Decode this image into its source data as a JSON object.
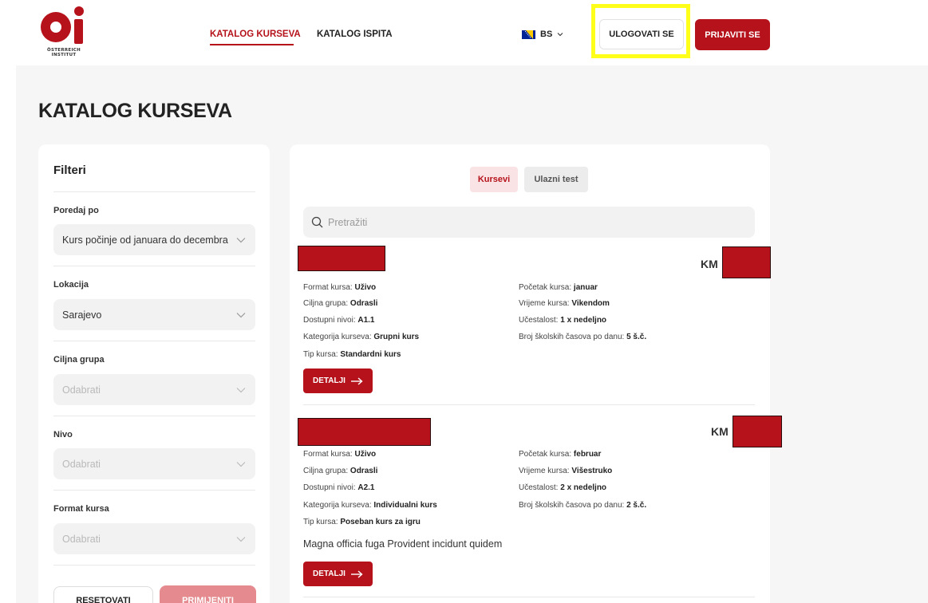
{
  "header": {
    "logo_text_line1": "ÖSTERREICH",
    "logo_text_line2": "INSTITUT",
    "nav": [
      {
        "label": "KATALOG KURSEVA",
        "active": true
      },
      {
        "label": "KATALOG ISPITA",
        "active": false
      }
    ],
    "language": "BS",
    "login_label": "ULOGOVATI SE",
    "register_label": "PRIJAVITI SE"
  },
  "page_title": "KATALOG KURSEVA",
  "filters": {
    "title": "Filteri",
    "groups": [
      {
        "label": "Poredaj po",
        "value": "Kurs počinje od januara do decembra",
        "is_placeholder": false
      },
      {
        "label": "Lokacija",
        "value": "Sarajevo",
        "is_placeholder": false
      },
      {
        "label": "Ciljna grupa",
        "value": "Odabrati",
        "is_placeholder": true
      },
      {
        "label": "Nivo",
        "value": "Odabrati",
        "is_placeholder": true
      },
      {
        "label": "Format kursa",
        "value": "Odabrati",
        "is_placeholder": true
      }
    ],
    "reset_label": "RESETOVATI",
    "apply_label": "PRIMIJENITI"
  },
  "results": {
    "tabs": [
      {
        "label": "Kursevi",
        "active": true
      },
      {
        "label": "Ulazni test",
        "active": false
      }
    ],
    "search_placeholder": "Pretražiti",
    "courses": [
      {
        "price_label": "KM",
        "left": [
          {
            "label": "Format kursa: ",
            "value": "Uživo"
          },
          {
            "label": "Ciljna grupa: ",
            "value": "Odrasli"
          },
          {
            "label": "Dostupni nivoi: ",
            "value": "A1.1"
          },
          {
            "label": "Kategorija kurseva: ",
            "value": "Grupni kurs"
          },
          {
            "label": "Tip kursa: ",
            "value": "Standardni kurs"
          }
        ],
        "right": [
          {
            "label": "Početak kursa: ",
            "value": "januar"
          },
          {
            "label": "Vrijeme kursa: ",
            "value": "Vikendom"
          },
          {
            "label": "Učestalost: ",
            "value": "1 x nedeljno"
          },
          {
            "label": "Broj školskih časova po danu: ",
            "value": "5 š.č."
          }
        ],
        "description": "",
        "details_label": "DETALJI"
      },
      {
        "price_label": "KM",
        "left": [
          {
            "label": "Format kursa: ",
            "value": "Uživo"
          },
          {
            "label": "Ciljna grupa: ",
            "value": "Odrasli"
          },
          {
            "label": "Dostupni nivoi: ",
            "value": "A2.1"
          },
          {
            "label": "Kategorija kurseva: ",
            "value": "Individualni kurs"
          },
          {
            "label": "Tip kursa: ",
            "value": "Poseban kurs za igru"
          }
        ],
        "right": [
          {
            "label": "Početak kursa: ",
            "value": "februar"
          },
          {
            "label": "Vrijeme kursa: ",
            "value": "Višestruko"
          },
          {
            "label": "Učestalost: ",
            "value": "2 x nedeljno"
          },
          {
            "label": "Broj školskih časova po danu: ",
            "value": "2 š.č."
          }
        ],
        "description": "Magna officia fuga Provident incidunt quidem",
        "details_label": "DETALJI"
      }
    ]
  },
  "colors": {
    "brand_red": "#b5121b",
    "highlight": "#ffff1a",
    "page_background": "#f6f6f6"
  }
}
